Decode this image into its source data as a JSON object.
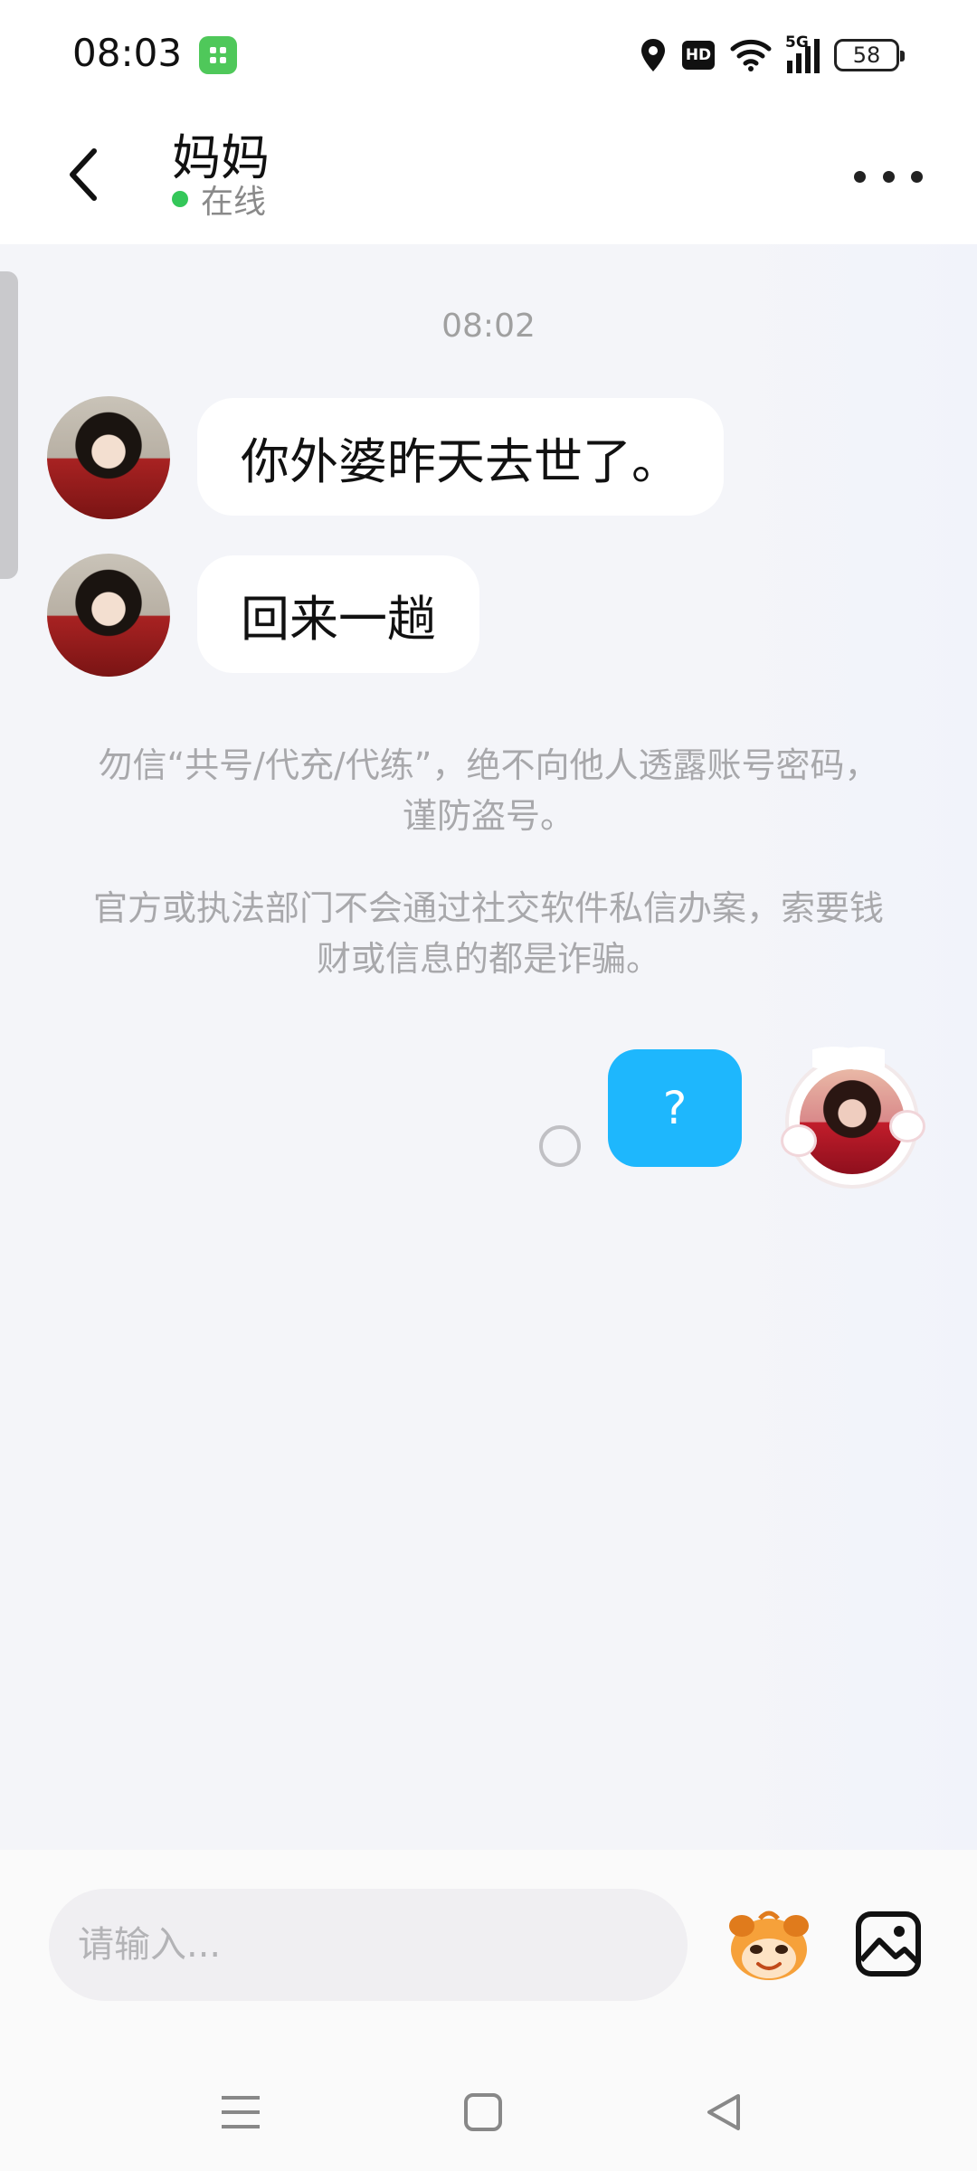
{
  "status_bar": {
    "time": "08:03",
    "network": "5G",
    "hd": "HD",
    "battery": "58",
    "icons": [
      "app-store-icon",
      "location-icon",
      "hd-icon",
      "wifi-icon",
      "signal-icon",
      "battery-icon"
    ]
  },
  "header": {
    "contact_name": "妈妈",
    "status": "在线",
    "status_color": "#34c759",
    "icons": [
      "back-arrow-icon",
      "more-dots-icon"
    ]
  },
  "chat": {
    "timestamp": "08:02",
    "incoming": [
      {
        "text": "你外婆昨天去世了。"
      },
      {
        "text": "回来一趟"
      }
    ],
    "notices": [
      "勿信“共号/代充/代练”，绝不向他人透露账号密码，谨防盗号。",
      "官方或执法部门不会通过社交软件私信办案，索要钱财或信息的都是诈骗。"
    ],
    "outgoing": [
      {
        "text": "?",
        "bubble_color": "#1eb7fd",
        "state": "sending"
      }
    ]
  },
  "input_bar": {
    "placeholder": "请输入...",
    "icons": [
      "emoji-mascot-icon",
      "image-icon"
    ]
  },
  "nav_bar": {
    "icons": [
      "menu-icon",
      "home-icon",
      "back-icon"
    ]
  }
}
